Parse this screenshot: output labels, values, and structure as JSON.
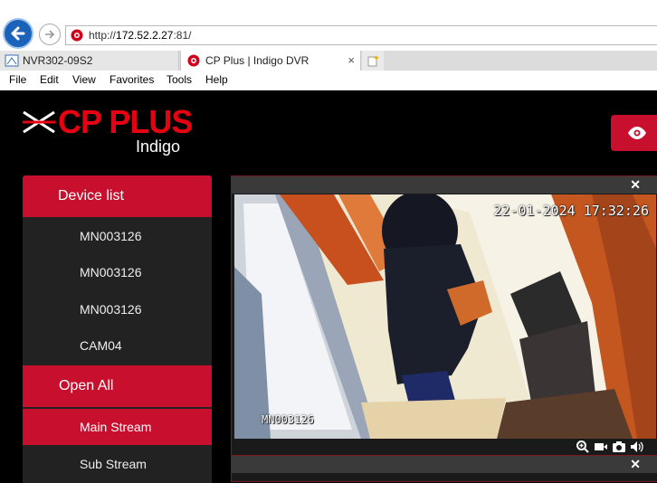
{
  "browser": {
    "url_prefix": "http://",
    "url_host": "172.52.2.27",
    "url_rest": ":81/",
    "tabs": [
      {
        "label": "NVR302-09S2"
      },
      {
        "label": "CP Plus | Indigo DVR"
      }
    ],
    "close_tab_glyph": "×",
    "menu": [
      "File",
      "Edit",
      "View",
      "Favorites",
      "Tools",
      "Help"
    ]
  },
  "brand": {
    "name": "CP PLUS",
    "sub": "Indigo",
    "color": "#e60012"
  },
  "sidebar": {
    "device_list_label": "Device list",
    "devices": [
      "MN003126",
      "MN003126",
      "MN003126",
      "CAM04"
    ],
    "open_all_label": "Open All",
    "streams": [
      {
        "label": "Main Stream",
        "selected": true
      },
      {
        "label": "Sub Stream",
        "selected": false
      }
    ]
  },
  "video": {
    "timestamp": "22-01-2024 17:32:26",
    "channel_name": "MN003126",
    "close_glyph": "✕"
  },
  "colors": {
    "accent": "#c8102e",
    "panel_border": "#7a1b24"
  },
  "icons": [
    "back-arrow-icon",
    "forward-arrow-icon",
    "site-favicon",
    "new-tab-icon",
    "eye-icon",
    "zoom-icon",
    "record-icon",
    "snapshot-icon",
    "audio-icon"
  ]
}
